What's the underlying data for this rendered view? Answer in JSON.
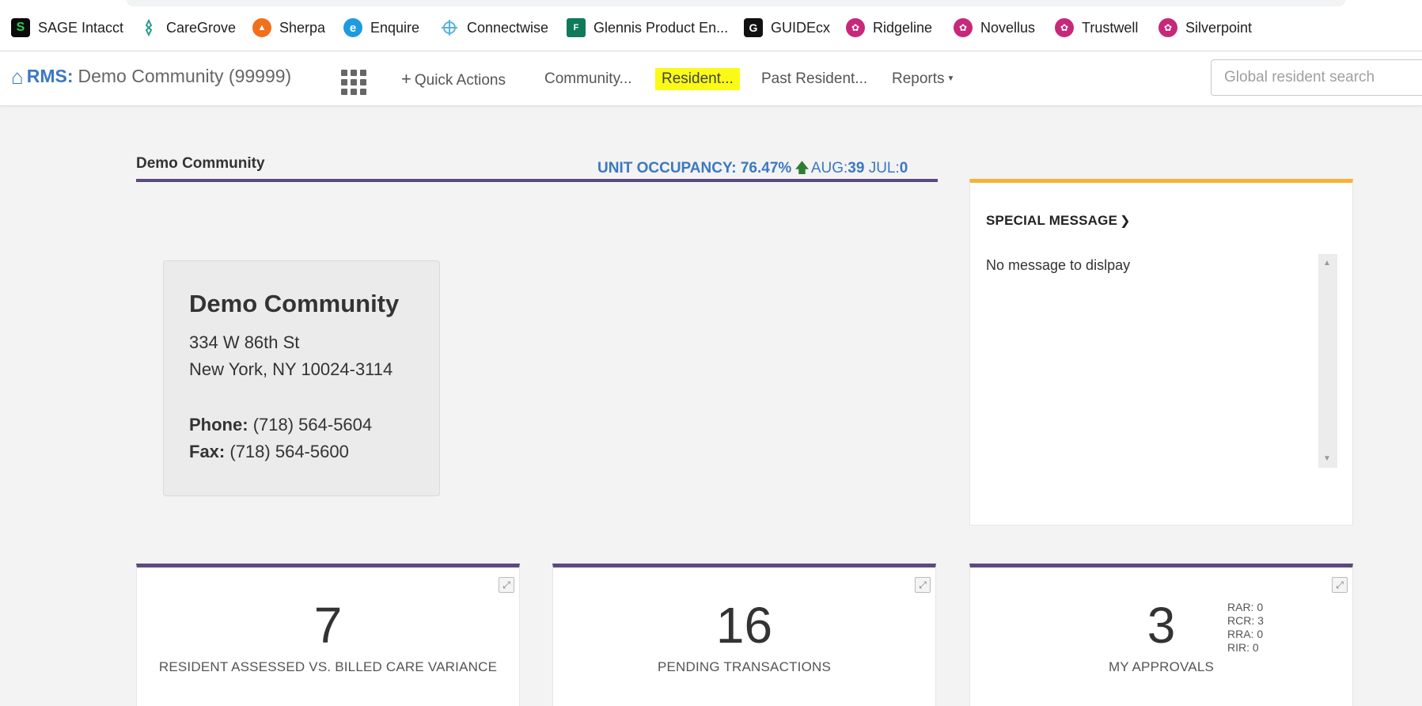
{
  "bookmarks": [
    {
      "label": "SAGE Intacct",
      "icon": "sage-intacct-icon"
    },
    {
      "label": "CareGrove",
      "icon": "caregrove-icon"
    },
    {
      "label": "Sherpa",
      "icon": "sherpa-icon"
    },
    {
      "label": "Enquire",
      "icon": "enquire-icon"
    },
    {
      "label": "Connectwise",
      "icon": "connectwise-icon"
    },
    {
      "label": "Glennis Product En...",
      "icon": "glennis-icon"
    },
    {
      "label": "GUIDEcx",
      "icon": "guidecx-icon"
    },
    {
      "label": "Ridgeline",
      "icon": "ridgeline-icon"
    },
    {
      "label": "Novellus",
      "icon": "novellus-icon"
    },
    {
      "label": "Trustwell",
      "icon": "trustwell-icon"
    },
    {
      "label": "Silverpoint",
      "icon": "silverpoint-icon"
    }
  ],
  "nav": {
    "brand": "RMS:",
    "community": "Demo Community (99999)",
    "quick_actions": "Quick Actions",
    "community_menu": "Community...",
    "resident_menu": "Resident...",
    "past_resident_menu": "Past Resident...",
    "reports_menu": "Reports",
    "search_placeholder": "Global resident search"
  },
  "header": {
    "community_title": "Demo Community",
    "occupancy_label": "UNIT OCCUPANCY: 76.47%",
    "aug_label": "AUG:",
    "aug_value": "39",
    "jul_label": "JUL:",
    "jul_value": "0"
  },
  "address_card": {
    "name": "Demo Community",
    "street": "334 W 86th St",
    "city_line": "New York, NY 10024-3114",
    "phone_label": "Phone:",
    "phone": "(718) 564-5604",
    "fax_label": "Fax:",
    "fax": "(718) 564-5600"
  },
  "special_message": {
    "title": "SPECIAL MESSAGE",
    "body": "No message to dislpay"
  },
  "stats": [
    {
      "value": "7",
      "label": "RESIDENT ASSESSED VS. BILLED CARE VARIANCE"
    },
    {
      "value": "16",
      "label": "PENDING TRANSACTIONS"
    },
    {
      "value": "3",
      "label": "MY APPROVALS"
    }
  ],
  "approvals_breakdown": [
    "RAR: 0",
    "RCR: 3",
    "RRA: 0",
    "RIR: 0"
  ],
  "colors": {
    "accent_blue": "#3b78c2",
    "purple_rule": "#5c4a7f",
    "message_accent": "#f8b335",
    "highlight": "#fafa16"
  }
}
